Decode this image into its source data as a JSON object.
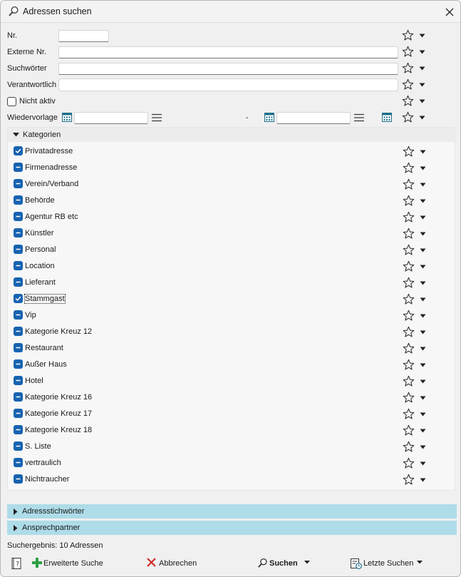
{
  "window": {
    "title": "Adressen suchen"
  },
  "fields": {
    "nr": {
      "label": "Nr.",
      "value": ""
    },
    "externe_nr": {
      "label": "Externe Nr.",
      "value": ""
    },
    "suchwoerter": {
      "label": "Suchwörter",
      "value": ""
    },
    "verantwortlich": {
      "label": "Verantwortlich",
      "value": ""
    },
    "nicht_aktiv": {
      "label": "Nicht aktiv",
      "checked": false
    },
    "wiedervorlage": {
      "label": "Wiedervorlage",
      "from": "",
      "to": "",
      "separator": "-"
    }
  },
  "kategorien": {
    "title": "Kategorien",
    "items": [
      {
        "label": "Privatadresse",
        "state": "checked"
      },
      {
        "label": "Firmenadresse",
        "state": "minus"
      },
      {
        "label": "Verein/Verband",
        "state": "minus"
      },
      {
        "label": "Behörde",
        "state": "minus"
      },
      {
        "label": "Agentur RB etc",
        "state": "minus"
      },
      {
        "label": "Künstler",
        "state": "minus"
      },
      {
        "label": "Personal",
        "state": "minus"
      },
      {
        "label": "Location",
        "state": "minus"
      },
      {
        "label": "Lieferant",
        "state": "minus"
      },
      {
        "label": "Stammgast",
        "state": "checked",
        "focused": true
      },
      {
        "label": "Vip",
        "state": "minus"
      },
      {
        "label": "Kategorie Kreuz 12",
        "state": "minus"
      },
      {
        "label": "Restaurant",
        "state": "minus"
      },
      {
        "label": "Außer Haus",
        "state": "minus"
      },
      {
        "label": "Hotel",
        "state": "minus"
      },
      {
        "label": "Kategorie Kreuz 16",
        "state": "minus"
      },
      {
        "label": "Kategorie Kreuz 17",
        "state": "minus"
      },
      {
        "label": "Kategorie Kreuz 18",
        "state": "minus"
      },
      {
        "label": "S. Liste",
        "state": "minus"
      },
      {
        "label": "vertraulich",
        "state": "minus"
      },
      {
        "label": "Nichtraucher",
        "state": "minus"
      }
    ]
  },
  "sections": {
    "adressstichwoerter": "Adressstichwörter",
    "ansprechpartner": "Ansprechpartner"
  },
  "status": {
    "result": "Suchergebnis: 10 Adressen"
  },
  "footer": {
    "erweiterte_suche": "Erweiterte Suche",
    "abbrechen": "Abbrechen",
    "suchen": "Suchen",
    "letzte_suchen": "Letzte Suchen"
  },
  "colors": {
    "checkbox_fill": "#1763b0",
    "section_bar": "#aedce8",
    "cancel_red": "#d22b2b",
    "add_green": "#2ea043",
    "calendar_teal": "#1f6f8b"
  }
}
